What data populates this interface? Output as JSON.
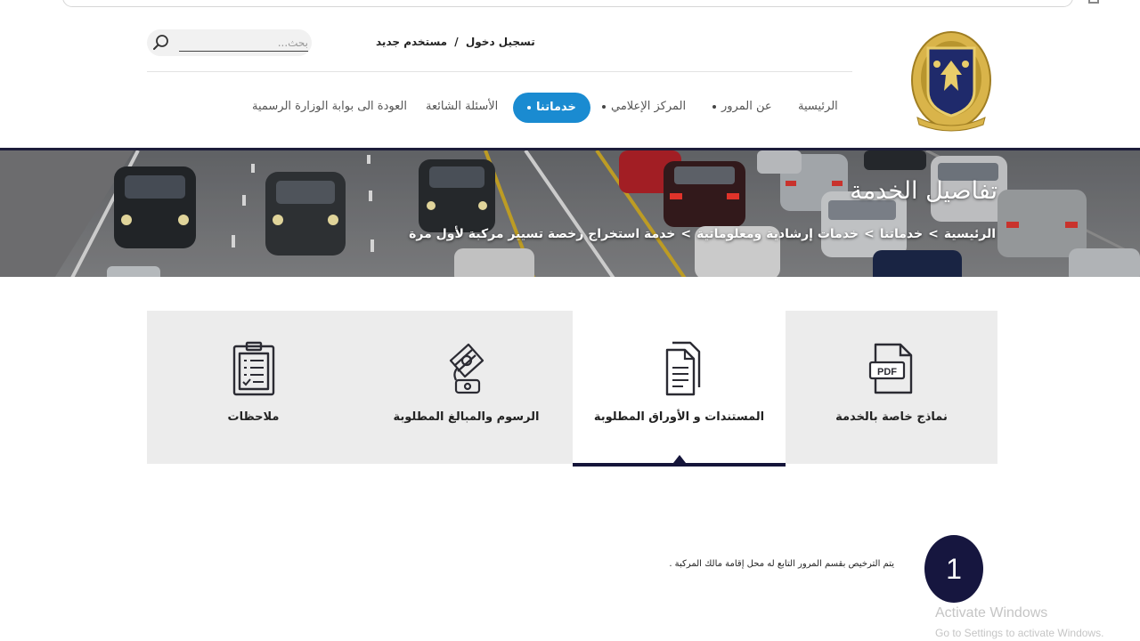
{
  "header": {
    "top_links": {
      "login": "تسجيل دخول",
      "separator": "/",
      "register": "مستخدم جديد"
    },
    "search": {
      "placeholder": "بحث..."
    }
  },
  "nav": {
    "items": [
      {
        "label": "الرئيسية",
        "has_dropdown": false
      },
      {
        "label": "عن المرور",
        "has_dropdown": true
      },
      {
        "label": "المركز الإعلامي",
        "has_dropdown": true
      },
      {
        "label": "خدماتنا",
        "has_dropdown": true,
        "active": true
      },
      {
        "label": "الأسئلة الشائعة",
        "has_dropdown": false
      },
      {
        "label": "العودة الى بوابة الوزارة الرسمية",
        "has_dropdown": false
      }
    ]
  },
  "banner": {
    "title": "تفاصيل الخدمة",
    "breadcrumb": [
      "الرئيسية",
      "خدماتنا",
      "خدمات إرشادية ومعلوماتية",
      "خدمة استخراج رخصة تسيير مركبة لأول مرة"
    ],
    "breadcrumb_separator": ">"
  },
  "tabs": [
    {
      "label": "نماذج خاصة بالخدمة",
      "icon": "pdf-file-icon",
      "active": false
    },
    {
      "label": "المستندات و الأوراق المطلوبة",
      "icon": "documents-icon",
      "active": true
    },
    {
      "label": "الرسوم والمبالغ المطلوبة",
      "icon": "money-fees-icon",
      "active": false
    },
    {
      "label": "ملاحظات",
      "icon": "clipboard-notes-icon",
      "active": false
    }
  ],
  "content": {
    "steps": [
      {
        "number": "1",
        "text": "يتم الترخيص بقسم المرور التابع له محل إقامة مالك المركبة ."
      }
    ]
  },
  "watermark": {
    "line1": "Activate Windows",
    "line2": "Go to Settings to activate Windows."
  },
  "colors": {
    "accent": "#1a8bd1",
    "navy": "#16163f",
    "tab_bg": "#ececec"
  }
}
